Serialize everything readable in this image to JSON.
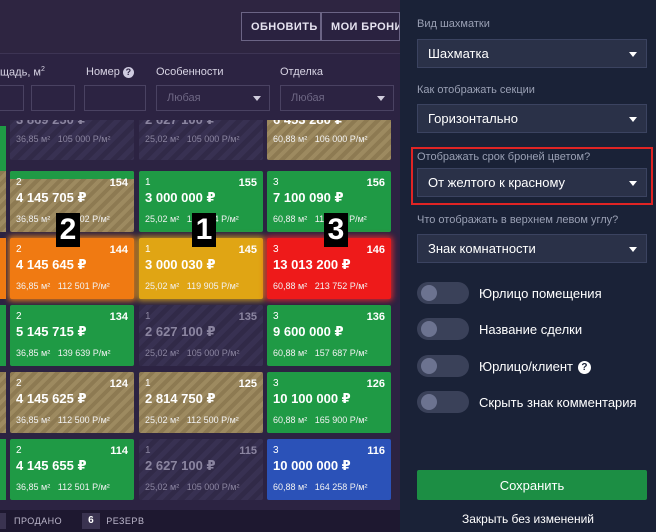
{
  "topbar": {
    "refresh": "ОБНОВИТЬ",
    "my_bookings": "МОИ БРОНИ"
  },
  "filters": {
    "area_label": "щадь, м",
    "area_sup": "2",
    "number_label": "Номер",
    "features_label": "Особенности",
    "features_value": "Любая",
    "finish_label": "Отделка",
    "finish_value": "Любая"
  },
  "cells": [
    {
      "col": 0,
      "row": 0,
      "rooms": "",
      "num": "",
      "price": "3 869 250 ₽",
      "area": "36,85 м²",
      "ppm": "105 000 Р/м²"
    },
    {
      "col": 1,
      "row": 0,
      "rooms": "",
      "num": "",
      "price": "2 627 100 ₽",
      "area": "25,02 м²",
      "ppm": "105 000 Р/м²"
    },
    {
      "col": 2,
      "row": 0,
      "rooms": "",
      "num": "",
      "price": "6 453 280 ₽",
      "area": "60,88 м²",
      "ppm": "106 000 Р/м²"
    },
    {
      "col": 0,
      "row": 1,
      "rooms": "2",
      "num": "154",
      "price": "4 145 705 ₽",
      "area": "36,85 м²",
      "ppm": "112 502 Р/м²"
    },
    {
      "col": 1,
      "row": 1,
      "rooms": "1",
      "num": "155",
      "price": "3 000 000 ₽",
      "area": "25,02 м²",
      "ppm": "119 904 Р/м²"
    },
    {
      "col": 2,
      "row": 1,
      "rooms": "3",
      "num": "156",
      "price": "7 100 090 ₽",
      "area": "60,88 м²",
      "ppm": "116 624 Р/м²"
    },
    {
      "col": 0,
      "row": 2,
      "rooms": "2",
      "num": "144",
      "price": "4 145 645 ₽",
      "area": "36,85 м²",
      "ppm": "112 501 Р/м²"
    },
    {
      "col": 1,
      "row": 2,
      "rooms": "1",
      "num": "145",
      "price": "3 000 030 ₽",
      "area": "25,02 м²",
      "ppm": "119 905 Р/м²"
    },
    {
      "col": 2,
      "row": 2,
      "rooms": "3",
      "num": "146",
      "price": "13 013 200 ₽",
      "area": "60,88 м²",
      "ppm": "213 752 Р/м²"
    },
    {
      "col": 0,
      "row": 3,
      "rooms": "2",
      "num": "134",
      "price": "5 145 715 ₽",
      "area": "36,85 м²",
      "ppm": "139 639 Р/м²"
    },
    {
      "col": 1,
      "row": 3,
      "rooms": "1",
      "num": "135",
      "price": "2 627 100 ₽",
      "area": "25,02 м²",
      "ppm": "105 000 Р/м²"
    },
    {
      "col": 2,
      "row": 3,
      "rooms": "3",
      "num": "136",
      "price": "9 600 000 ₽",
      "area": "60,88 м²",
      "ppm": "157 687 Р/м²"
    },
    {
      "col": 0,
      "row": 4,
      "rooms": "2",
      "num": "124",
      "price": "4 145 625 ₽",
      "area": "36,85 м²",
      "ppm": "112 500 Р/м²"
    },
    {
      "col": 1,
      "row": 4,
      "rooms": "1",
      "num": "125",
      "price": "2 814 750 ₽",
      "area": "25,02 м²",
      "ppm": "112 500 Р/м²"
    },
    {
      "col": 2,
      "row": 4,
      "rooms": "3",
      "num": "126",
      "price": "10 100 000 ₽",
      "area": "60,88 м²",
      "ppm": "165 900 Р/м²"
    },
    {
      "col": 0,
      "row": 5,
      "rooms": "2",
      "num": "114",
      "price": "4 145 655 ₽",
      "area": "36,85 м²",
      "ppm": "112 501 Р/м²"
    },
    {
      "col": 1,
      "row": 5,
      "rooms": "1",
      "num": "115",
      "price": "2 627 100 ₽",
      "area": "25,02 м²",
      "ppm": "105 000 Р/м²"
    },
    {
      "col": 2,
      "row": 5,
      "rooms": "3",
      "num": "116",
      "price": "10 000 000 ₽",
      "area": "60,88 м²",
      "ppm": "164 258 Р/м²"
    }
  ],
  "annotations": {
    "a1": "1",
    "a2": "2",
    "a3": "3"
  },
  "legend": {
    "sold": "ПРОДАНО",
    "reserve_count": "6",
    "reserve": "РЕЗЕРВ"
  },
  "panel": {
    "view_label": "Вид шахматки",
    "view_value": "Шахматка",
    "sections_label": "Как отображать секции",
    "sections_value": "Горизонтально",
    "booking_label": "Отображать срок броней цветом?",
    "booking_value": "От желтого к красному",
    "corner_label": "Что отображать в верхнем левом углу?",
    "corner_value": "Знак комнатности",
    "toggles": [
      "Юрлицо помещения",
      "Название сделки",
      "Юрлицо/клиент",
      "Скрыть знак комментария"
    ],
    "save": "Сохранить",
    "close": "Закрыть без изменений"
  }
}
